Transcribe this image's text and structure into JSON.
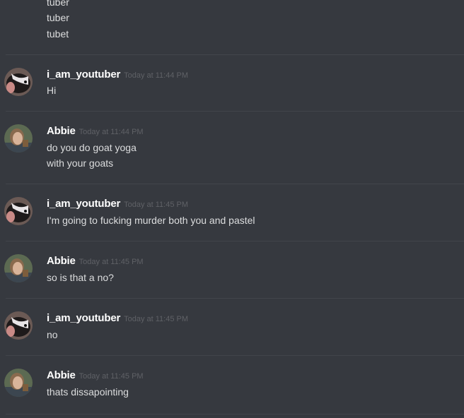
{
  "continuation": [
    "tuber",
    "tuber",
    "tubet"
  ],
  "messages": [
    {
      "author": "i_am_youtuber",
      "avatar": "skunk-avatar",
      "time": "Today at 11:44 PM",
      "lines": [
        "Hi"
      ]
    },
    {
      "author": "Abbie",
      "avatar": "person-avatar",
      "time": "Today at 11:44 PM",
      "lines": [
        "do you do goat yoga",
        "with your goats"
      ]
    },
    {
      "author": "i_am_youtuber",
      "avatar": "skunk-avatar",
      "time": "Today at 11:45 PM",
      "lines": [
        "I'm going to fucking murder both you and pastel"
      ]
    },
    {
      "author": "Abbie",
      "avatar": "person-avatar",
      "time": "Today at 11:45 PM",
      "lines": [
        "so is that a no?"
      ]
    },
    {
      "author": "i_am_youtuber",
      "avatar": "skunk-avatar",
      "time": "Today at 11:45 PM",
      "lines": [
        "no"
      ]
    },
    {
      "author": "Abbie",
      "avatar": "person-avatar",
      "time": "Today at 11:45 PM",
      "lines": [
        "thats dissapointing"
      ]
    }
  ],
  "colors": {
    "background": "#36393f",
    "divider": "#42454b",
    "username": "#ffffff",
    "timestamp": "#5f6166",
    "text": "#dcddde"
  }
}
